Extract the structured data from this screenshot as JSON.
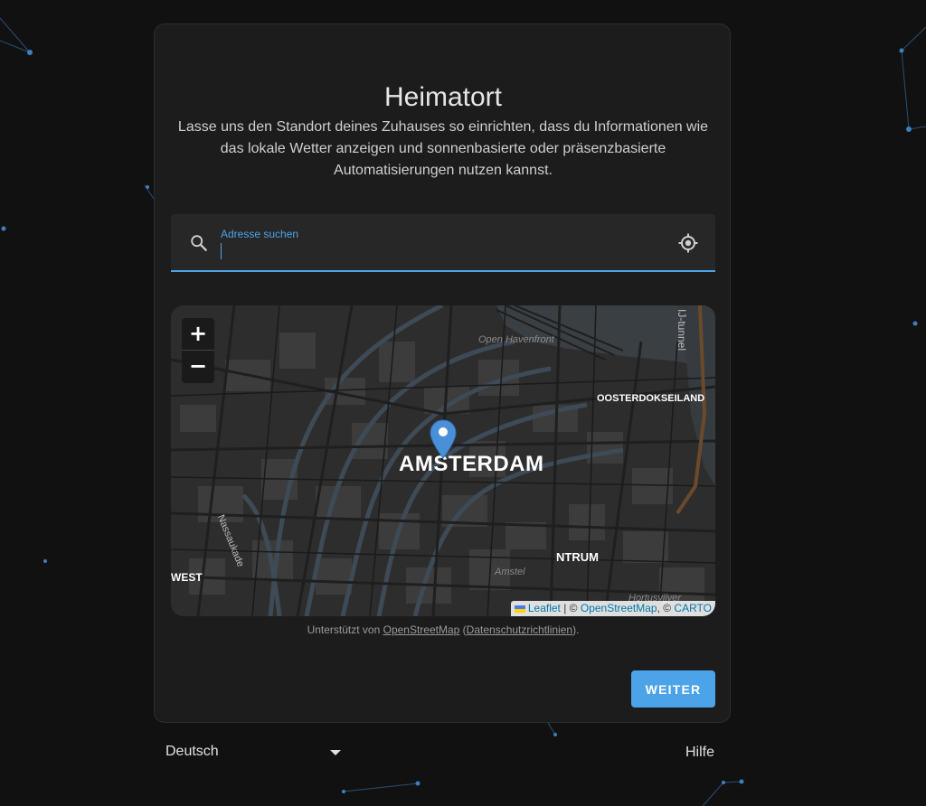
{
  "onboarding": {
    "title": "Heimatort",
    "intro": "Lasse uns den Standort deines Zuhauses so einrichten, dass du Informationen wie das lokale Wetter anzeigen und sonnenbasierte oder präsenzbasierte Automatisierungen nutzen kannst."
  },
  "search": {
    "label": "Adresse suchen",
    "value": "",
    "icon": "search-icon",
    "locate_icon": "my-location-icon"
  },
  "map": {
    "zoom_in": "+",
    "zoom_out": "−",
    "labels": {
      "city": "AMSTERDAM",
      "oosterdokseiland": "OOSTERDOKSEILAND",
      "centrum": "NTRUM",
      "west": "WEST",
      "havenfront": "Open Havenfront",
      "nassaukade": "Nassaukade",
      "amstel": "Amstel",
      "tunnel": "IJ-tunnel",
      "hortus": "Hortusvijver"
    },
    "attribution": {
      "leaflet": "Leaflet",
      "sep1": " | © ",
      "osm": "OpenStreetMap",
      "sep2": ", © ",
      "carto": "CARTO"
    },
    "pin_color": "#4a90d9"
  },
  "powered_by": {
    "prefix": "Unterstützt von ",
    "osm_link": "OpenStreetMap",
    "open": " (",
    "privacy_link": "Datenschutzrichtlinien",
    "close": ")."
  },
  "actions": {
    "next": "WEITER"
  },
  "footer": {
    "language": "Deutsch",
    "help": "Hilfe"
  },
  "colors": {
    "accent": "#4da3e8",
    "background": "#111111",
    "card": "#1c1c1c"
  }
}
